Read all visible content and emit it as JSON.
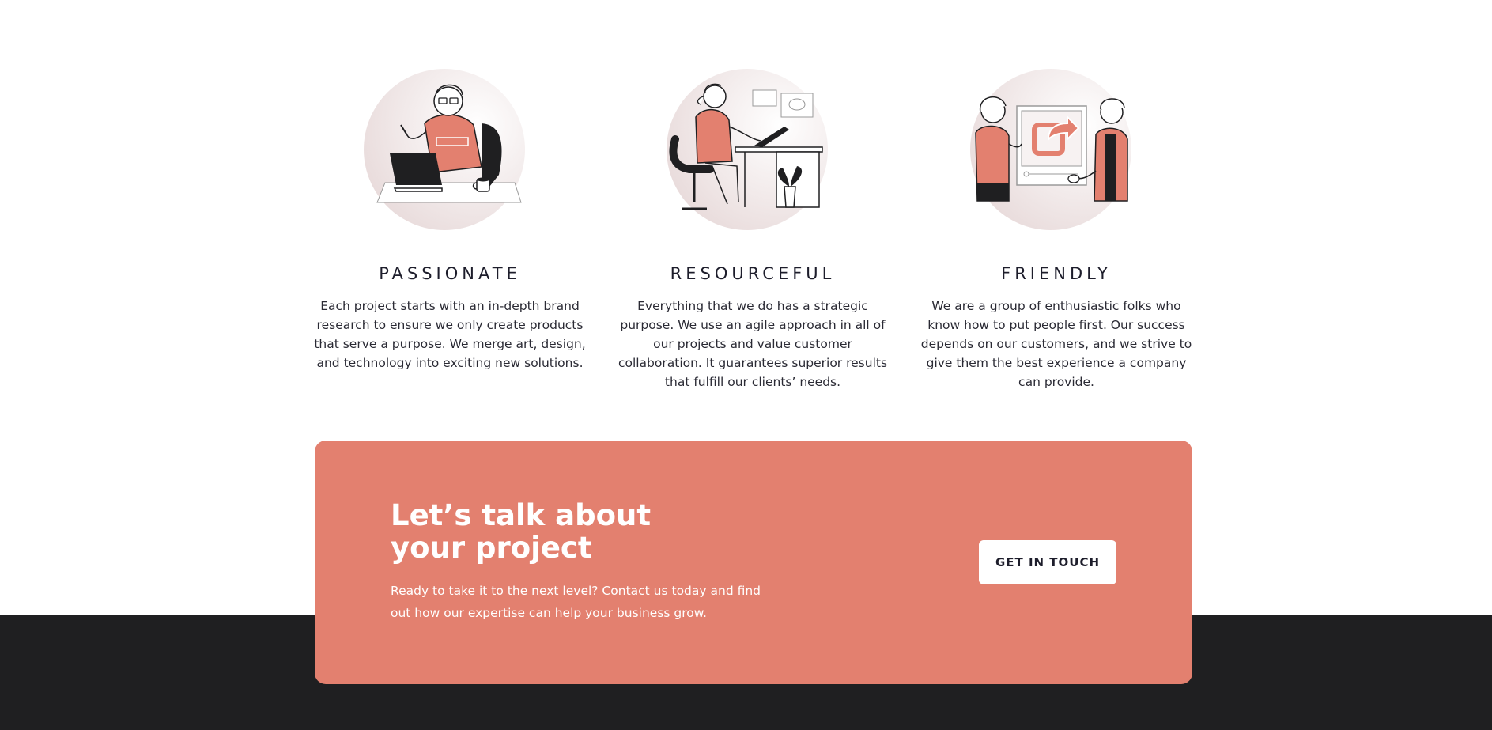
{
  "features": [
    {
      "illustration": "person-at-laptop-illustration",
      "title": "PASSIONATE",
      "description": "Each project starts with an in-depth brand research to ensure we only create products that serve a purpose. We merge art, design, and technology into exciting new solutions."
    },
    {
      "illustration": "person-at-drawing-desk-illustration",
      "title": "RESOURCEFUL",
      "description": "Everything that we do has a strategic purpose. We use an agile approach in all of our projects and value customer collaboration. It guarantees superior results that fulfill our clients’ needs."
    },
    {
      "illustration": "two-people-with-share-board-illustration",
      "title": "FRIENDLY",
      "description": "We are a group of enthusiastic folks who know how to put people first. Our success depends on our customers, and we strive to give them the best experience a company can provide."
    }
  ],
  "cta": {
    "title": "Let’s talk about your project",
    "description": "Ready to take it to the next level? Contact us today and find out how our expertise can help your business grow.",
    "button_label": "GET IN TOUCH"
  },
  "colors": {
    "accent": "#e3806f",
    "footer": "#1f1f21",
    "text": "#1d1d2b",
    "circle": "#efe4e4"
  }
}
